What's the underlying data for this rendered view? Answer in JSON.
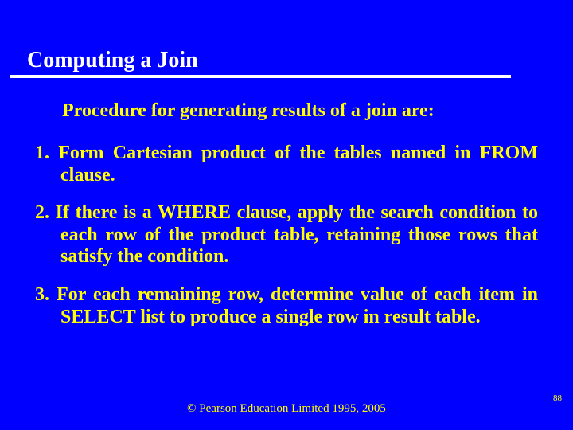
{
  "title": "Computing a Join",
  "intro": "Procedure for generating results of a join are:",
  "items": [
    "1. Form Cartesian product of the tables named in FROM clause.",
    "2. If there is a WHERE clause, apply the search condition to each row of the product table, retaining those rows that satisfy the condition.",
    "3. For each remaining row, determine value of each item in SELECT list to produce a single row in result table."
  ],
  "footer": "© Pearson Education Limited 1995, 2005",
  "page_number": "88"
}
